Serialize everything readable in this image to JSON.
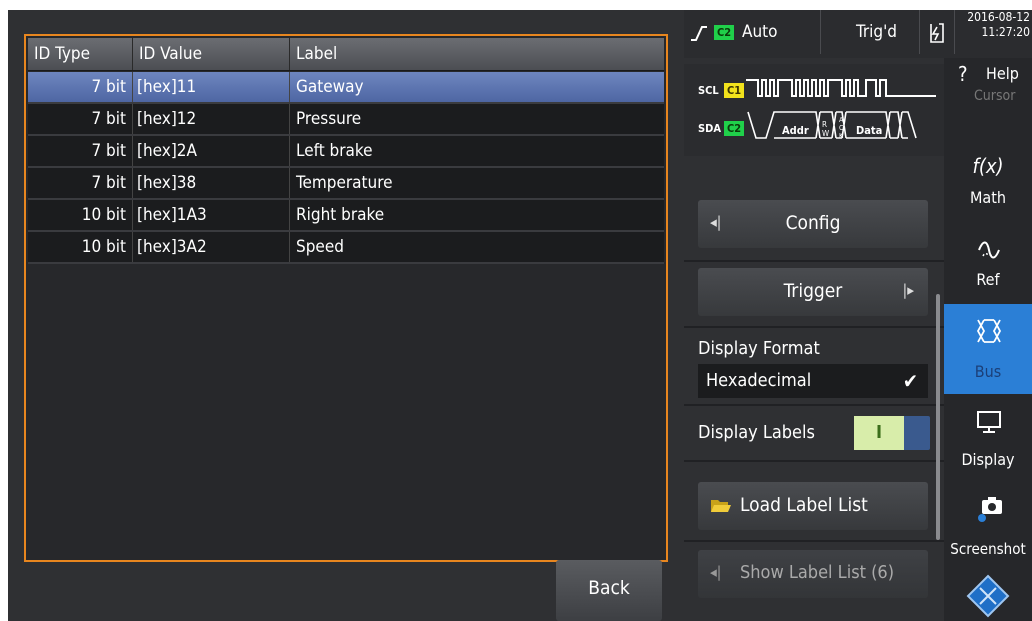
{
  "table": {
    "headers": [
      "ID Type",
      "ID Value",
      "Label"
    ],
    "rows": [
      {
        "type": "7 bit",
        "value": "[hex]11",
        "label": "Gateway",
        "selected": true
      },
      {
        "type": "7 bit",
        "value": "[hex]12",
        "label": "Pressure"
      },
      {
        "type": "7 bit",
        "value": "[hex]2A",
        "label": "Left brake"
      },
      {
        "type": "7 bit",
        "value": "[hex]38",
        "label": "Temperature"
      },
      {
        "type": "10 bit",
        "value": "[hex]1A3",
        "label": "Right brake"
      },
      {
        "type": "10 bit",
        "value": "[hex]3A2",
        "label": "Speed"
      }
    ]
  },
  "back_label": "Back",
  "status": {
    "channel": "C2",
    "mode": "Auto",
    "trig_state": "Trig'd",
    "date": "2016-08-12",
    "time": "11:27:20"
  },
  "decode": {
    "scl_label": "SCL",
    "scl_channel": "C1",
    "sda_label": "SDA",
    "sda_channel": "C2",
    "frame_addr": "Addr",
    "frame_rw": "R W",
    "frame_ack": "A C K",
    "frame_data": "Data"
  },
  "settings": {
    "config_label": "Config",
    "trigger_label": "Trigger",
    "display_format_label": "Display Format",
    "display_format_value": "Hexadecimal",
    "display_labels_label": "Display Labels",
    "toggle_on": "I",
    "load_label_list": "Load Label List",
    "show_label_list": "Show Label List (6)"
  },
  "toolbar": {
    "help": "Help",
    "help_glyph": "?",
    "cursor": "Cursor",
    "math_symbol": "f(x)",
    "math": "Math",
    "ref": "Ref",
    "bus": "Bus",
    "display": "Display",
    "screenshot": "Screenshot"
  },
  "colors": {
    "accent_orange": "#e8861f",
    "selected_row": "#5b74b4",
    "bus_active": "#2b7fd6",
    "c1_yellow": "#f2e21c",
    "c2_green": "#20d04a"
  }
}
